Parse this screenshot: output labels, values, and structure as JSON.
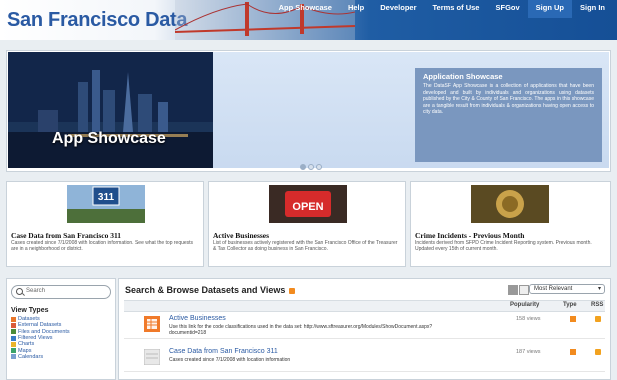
{
  "header": {
    "brand": "San Francisco Data",
    "nav": [
      "App Showcase",
      "Help",
      "Developer",
      "Terms of Use",
      "SFGov"
    ],
    "signup": "Sign Up",
    "signin": "Sign In"
  },
  "hero": {
    "title": "App Showcase",
    "showcase_title": "Application Showcase",
    "showcase_text": "The DataSF App Showcase is a collection of applications that have been developed and built by individuals and organizations using datasets published by the City & County of San Francisco. The apps in this showcase are a tangible result from individuals & organizations having open access to city data."
  },
  "features": [
    {
      "title": "Case Data from San Francisco 311",
      "desc": "Cases created since 7/1/2008 with location information. See what the top requests are in a neighborhood or district."
    },
    {
      "title": "Active Businesses",
      "desc": "List of businesses actively registered with the San Francisco Office of the Treasurer & Tax Collector as doing business in San Francisco."
    },
    {
      "title": "Crime Incidents - Previous Month",
      "desc": "Incidents derived from SFPD Crime Incident Reporting system. Previous month. Updated every 15th of current month."
    }
  ],
  "sidebar": {
    "search_placeholder": "Search",
    "view_types_title": "View Types",
    "view_types": [
      "Datasets",
      "External Datasets",
      "Files and Documents",
      "Filtered Views",
      "Charts",
      "Maps",
      "Calendars"
    ]
  },
  "main": {
    "title": "Search & Browse Datasets and Views",
    "sort": "Most Relevant",
    "columns": {
      "popularity": "Popularity",
      "type": "Type",
      "rss": "RSS"
    },
    "rows": [
      {
        "name": "Active Businesses",
        "desc": "Use this link for the code classifications used in the data set: http://www.sftreasurer.org/Modules/ShowDocument.aspx?documentid=218",
        "views": "158 views"
      },
      {
        "name": "Case Data from San Francisco 311",
        "desc": "Cases created since 7/1/2008 with location information",
        "views": "187 views"
      }
    ]
  },
  "colors": {
    "accent": "#2a5aa3",
    "rss": "#f28b1f",
    "header_blue": "#1f5da4"
  }
}
